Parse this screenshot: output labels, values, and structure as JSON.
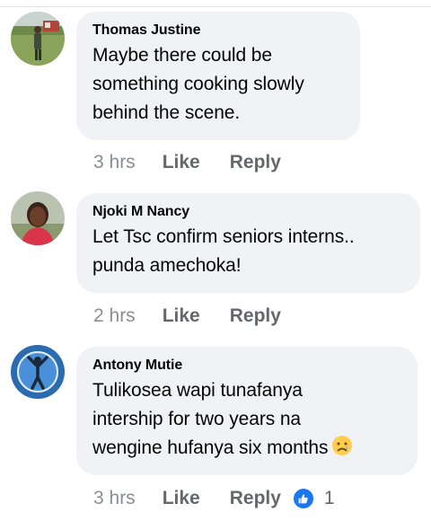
{
  "comments": [
    {
      "author": "Thomas Justine",
      "lines": [
        "Maybe there could be",
        "something cooking slowly",
        "behind the scene."
      ],
      "time": "3 hrs",
      "like_label": "Like",
      "reply_label": "Reply",
      "avatar_icon": "profile-photo-man-standing-outdoors"
    },
    {
      "author": "Njoki M Nancy",
      "lines": [
        "Let Tsc confirm seniors interns..",
        "punda amechoka!"
      ],
      "time": "2 hrs",
      "like_label": "Like",
      "reply_label": "Reply",
      "avatar_icon": "profile-photo-woman-portrait"
    },
    {
      "author": "Antony Mutie",
      "lines": [
        "Tulikosea wapi tunafanya",
        "intership for two years na",
        "wengine hufanya six months"
      ],
      "emoji": "😥",
      "time": "3 hrs",
      "like_label": "Like",
      "reply_label": "Reply",
      "reaction_icon": "like-reaction-icon",
      "reaction_count": "1",
      "avatar_icon": "profile-photo-runner-emblem"
    }
  ],
  "colors": {
    "bubble_bg": "#f0f2f5",
    "meta_text": "#65676b",
    "like_blue": "#1877f2"
  }
}
